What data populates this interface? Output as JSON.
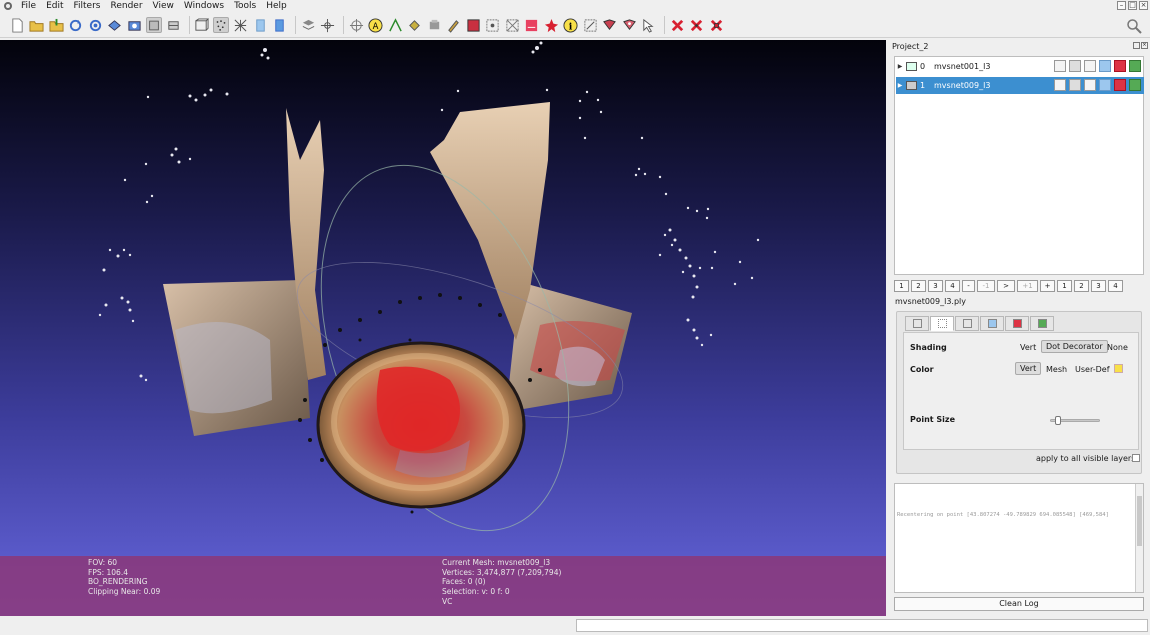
{
  "menu": [
    "File",
    "Edit",
    "Filters",
    "Render",
    "View",
    "Windows",
    "Tools",
    "Help"
  ],
  "project": {
    "title": "Project_2",
    "layers": [
      {
        "index": "0",
        "name": "mvsnet001_l3",
        "visible": true,
        "selected": false
      },
      {
        "index": "1",
        "name": "mvsnet009_l3",
        "visible": false,
        "selected": true
      }
    ]
  },
  "num_buttons": [
    "1",
    "2",
    "3",
    "4",
    "-",
    "-1",
    ">",
    "+1",
    "+",
    "1",
    "2",
    "3",
    "4"
  ],
  "mesh_filename": "mvsnet009_l3.ply",
  "decorator": {
    "shading_label": "Shading",
    "shading_options": [
      "Vert",
      "Dot Decorator",
      "None"
    ],
    "color_label": "Color",
    "color_options": [
      "Vert",
      "Mesh",
      "User-Def"
    ],
    "user_color": "#f8e048",
    "point_size_label": "Point Size",
    "point_size_value": 0.1,
    "apply_all_label": "apply to all visible layers"
  },
  "log": {
    "text": "Recentering on point [43.807274 -49.789829 694.085548] [469,584]",
    "clean_label": "Clean Log"
  },
  "info_left": [
    "FOV: 60",
    "FPS:   106.4",
    "BO_RENDERING",
    "Clipping Near:  0.09"
  ],
  "info_right": [
    "Current Mesh: mvsnet009_l3",
    "Vertices: 3,474,877    (7,209,794)",
    "Faces: 0     (0)",
    "Selection: v: 0 f: 0",
    "VC"
  ]
}
